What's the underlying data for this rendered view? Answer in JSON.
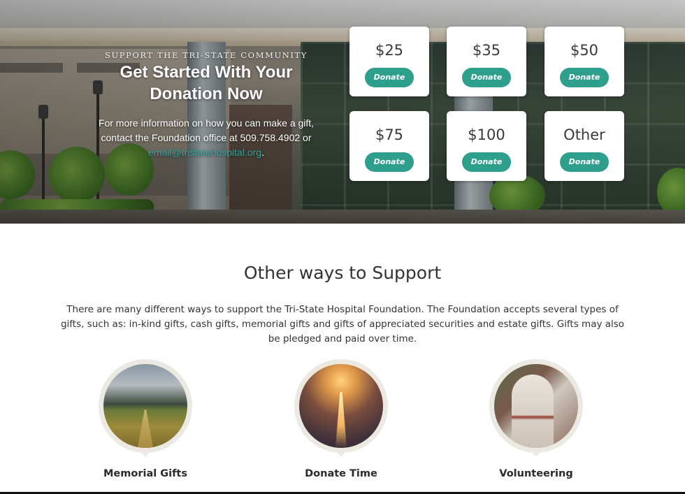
{
  "hero": {
    "eyebrow": "SUPPORT THE TRI-STATE COMMUNITY",
    "headline_line1": "Get Started With Your",
    "headline_line2": "Donation Now",
    "info_text_1": "For more information on how you can make a gift,",
    "info_text_2": "contact the Foundation office at 509.758.4902 or",
    "email": "email@tristatehospital.org",
    "email_suffix": "."
  },
  "donation_cards": [
    {
      "amount": "$25",
      "button": "Donate"
    },
    {
      "amount": "$35",
      "button": "Donate"
    },
    {
      "amount": "$50",
      "button": "Donate"
    },
    {
      "amount": "$75",
      "button": "Donate"
    },
    {
      "amount": "$100",
      "button": "Donate"
    },
    {
      "amount": "Other",
      "button": "Donate"
    }
  ],
  "support": {
    "title": "Other ways to Support",
    "description": "There are many different ways to support the Tri-State Hospital Foundation. The Foundation accepts several types of gifts, such as: in-kind gifts, cash gifts, memorial gifts and gifts of appreciated securities and estate gifts. Gifts may also be pledged and paid over time."
  },
  "ways": [
    {
      "title": "Memorial Gifts",
      "icon": "field-photo"
    },
    {
      "title": "Donate Time",
      "icon": "road-lights-photo"
    },
    {
      "title": "Volunteering",
      "icon": "walking-person-photo"
    }
  ],
  "colors": {
    "accent": "#2e9e8d",
    "link": "#30a5a0",
    "pin_bg": "#ece9e2"
  }
}
